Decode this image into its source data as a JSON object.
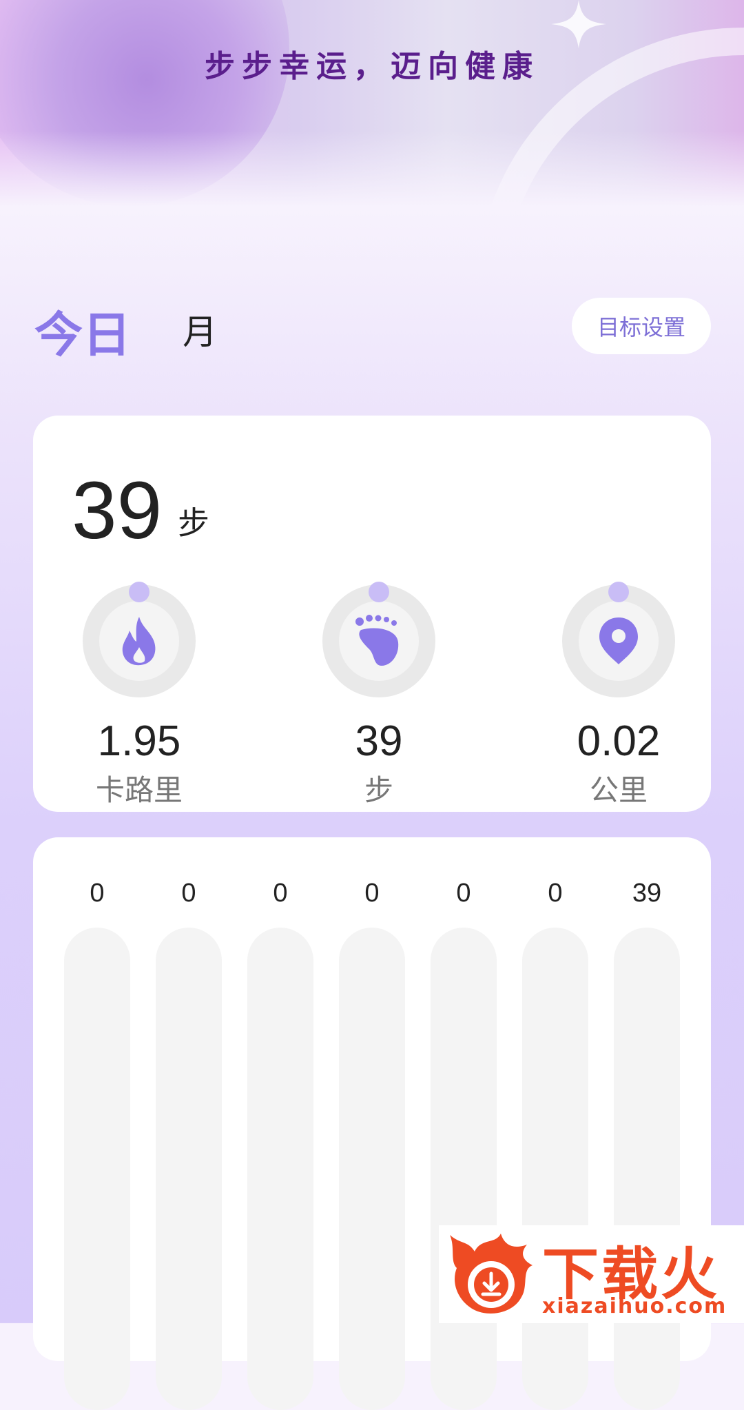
{
  "header": {
    "slogan": "步步幸运，迈向健康"
  },
  "tabs": {
    "today": "今日",
    "month": "月"
  },
  "goal_button": "目标设置",
  "summary": {
    "steps": "39",
    "steps_unit": "步",
    "metrics": [
      {
        "icon": "flame-icon",
        "value": "1.95",
        "label": "卡路里"
      },
      {
        "icon": "footprint-icon",
        "value": "39",
        "label": "步"
      },
      {
        "icon": "location-pin-icon",
        "value": "0.02",
        "label": "公里"
      }
    ]
  },
  "chart_data": {
    "type": "bar",
    "values": [
      0,
      0,
      0,
      0,
      0,
      0,
      39
    ],
    "value_labels": [
      "0",
      "0",
      "0",
      "0",
      "0",
      "0",
      "39"
    ]
  },
  "watermark": {
    "title": "下载火",
    "url": "xiazaihuo.com"
  },
  "colors": {
    "accent": "#8a78e8",
    "track": "#e9e9e9",
    "slogan": "#5a1e8c",
    "watermark": "#ee4b23"
  }
}
